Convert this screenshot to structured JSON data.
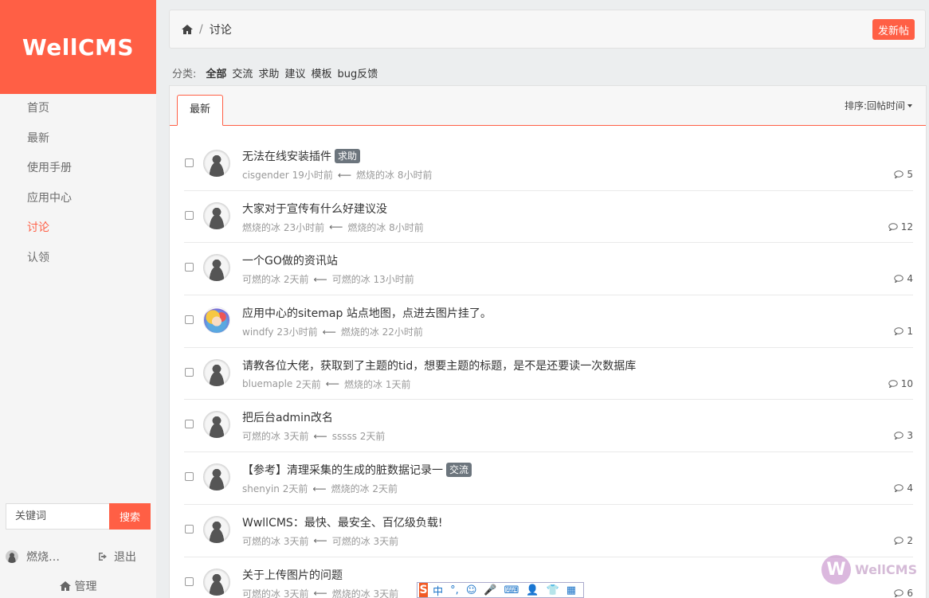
{
  "sidebar": {
    "logo": "WellCMS",
    "nav": [
      {
        "label": "首页",
        "active": false
      },
      {
        "label": "最新",
        "active": false
      },
      {
        "label": "使用手册",
        "active": false
      },
      {
        "label": "应用中心",
        "active": false
      },
      {
        "label": "讨论",
        "active": true
      },
      {
        "label": "认领",
        "active": false
      }
    ],
    "search": {
      "placeholder": "关键词",
      "button": "搜索"
    },
    "user": {
      "name": "燃烧…",
      "logout": "退出"
    },
    "admin": "管理"
  },
  "header": {
    "breadcrumb": "讨论",
    "new_post": "发新帖"
  },
  "categories": {
    "label": "分类:",
    "items": [
      {
        "label": "全部",
        "active": true
      },
      {
        "label": "交流",
        "active": false
      },
      {
        "label": "求助",
        "active": false
      },
      {
        "label": "建议",
        "active": false
      },
      {
        "label": "模板",
        "active": false
      },
      {
        "label": "bug反馈",
        "active": false
      }
    ]
  },
  "list": {
    "tab": "最新",
    "sort_label": "排序:",
    "sort_value": "回帖时间",
    "threads": [
      {
        "title": "无法在线安装插件",
        "tag": "求助",
        "author": "cisgender",
        "time": "19小时前",
        "last_user": "燃烧的冰",
        "last_time": "8小时前",
        "replies": "5",
        "avatar": "default"
      },
      {
        "title": "大家对于宣传有什么好建议没",
        "tag": "",
        "author": "燃烧的冰",
        "time": "23小时前",
        "last_user": "燃烧的冰",
        "last_time": "8小时前",
        "replies": "12",
        "avatar": "default"
      },
      {
        "title": "一个GO做的资讯站",
        "tag": "",
        "author": "可燃的冰",
        "time": "2天前",
        "last_user": "可燃的冰",
        "last_time": "13小时前",
        "replies": "4",
        "avatar": "default"
      },
      {
        "title": "应用中心的sitemap 站点地图，点进去图片挂了。",
        "tag": "",
        "author": "windfy",
        "time": "23小时前",
        "last_user": "燃烧的冰",
        "last_time": "22小时前",
        "replies": "1",
        "avatar": "custom"
      },
      {
        "title": "请教各位大佬，获取到了主题的tid，想要主题的标题，是不是还要读一次数据库",
        "tag": "",
        "author": "bluemaple",
        "time": "2天前",
        "last_user": "燃烧的冰",
        "last_time": "1天前",
        "replies": "10",
        "avatar": "default"
      },
      {
        "title": "把后台admin改名",
        "tag": "",
        "author": "可燃的冰",
        "time": "3天前",
        "last_user": "sssss",
        "last_time": "2天前",
        "replies": "3",
        "avatar": "default"
      },
      {
        "title": "【参考】清理采集的生成的脏数据记录一",
        "tag": "交流",
        "author": "shenyin",
        "time": "2天前",
        "last_user": "燃烧的冰",
        "last_time": "2天前",
        "replies": "4",
        "avatar": "default"
      },
      {
        "title": "WwllCMS：最快、最安全、百亿级负载!",
        "tag": "",
        "author": "可燃的冰",
        "time": "3天前",
        "last_user": "可燃的冰",
        "last_time": "3天前",
        "replies": "2",
        "avatar": "default"
      },
      {
        "title": "关于上传图片的问题",
        "tag": "",
        "author": "可燃的冰",
        "time": "3天前",
        "last_user": "燃烧的冰",
        "last_time": "3天前",
        "replies": "6",
        "avatar": "default"
      }
    ]
  },
  "watermark": "WellCMS",
  "ime": {
    "logo": "S",
    "mode": "中",
    "punct": "°,"
  }
}
